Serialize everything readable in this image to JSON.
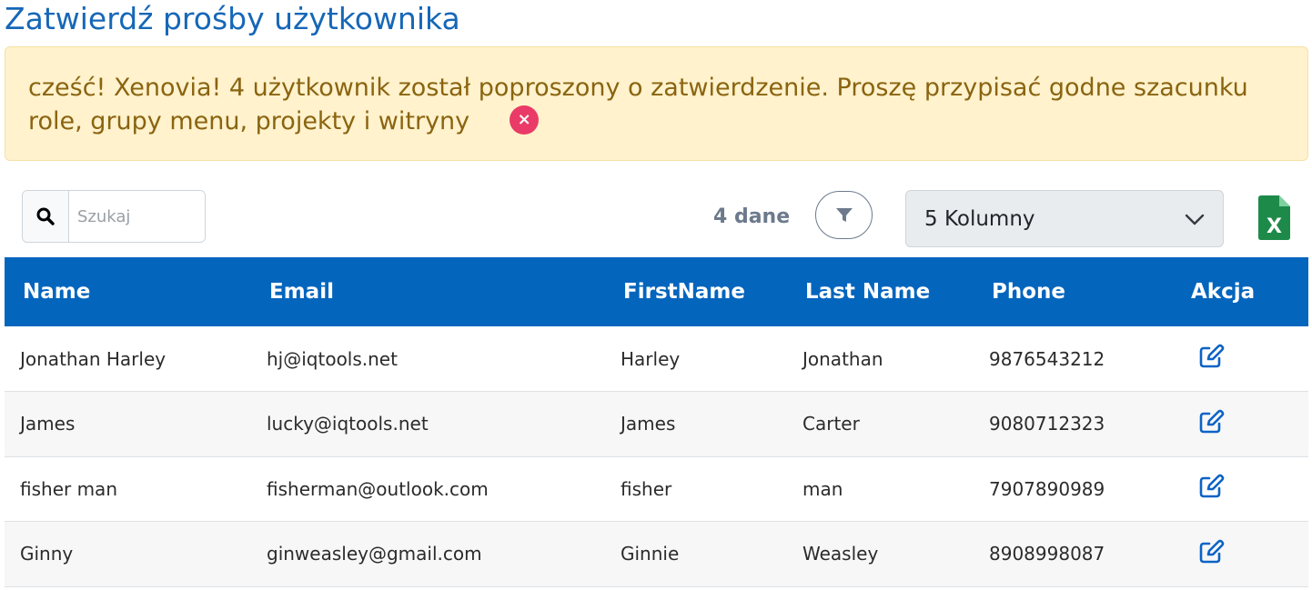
{
  "page": {
    "title": "Zatwierdź prośby użytkownika"
  },
  "alert": {
    "message": "cześć! Xenovia! 4 użytkownik został poproszony o zatwierdzenie. Proszę przypisać godne szacunku role, grupy menu, projekty i witryny",
    "close_glyph": "×",
    "color": "#8a6410",
    "background": "#fff2cd"
  },
  "toolbar": {
    "search_placeholder": "Szukaj",
    "search_value": "",
    "record_count": "4 dane",
    "columns_selected": "5 Kolumny",
    "icons": [
      "search-icon",
      "filter-icon",
      "chevron-down-icon",
      "excel-export-icon"
    ]
  },
  "table": {
    "header_color": "#0465bd",
    "columns": [
      "Name",
      "Email",
      "FirstName",
      "Last Name",
      "Phone",
      "Akcja"
    ],
    "rows": [
      {
        "name": "Jonathan Harley",
        "email": "hj@iqtools.net",
        "first_name": "Harley",
        "last_name": "Jonathan",
        "phone": "9876543212"
      },
      {
        "name": "James",
        "email": "lucky@iqtools.net",
        "first_name": "James",
        "last_name": "Carter",
        "phone": "9080712323"
      },
      {
        "name": "fisher man",
        "email": "fisherman@outlook.com",
        "first_name": "fisher",
        "last_name": "man",
        "phone": "7907890989"
      },
      {
        "name": "Ginny",
        "email": "ginweasley@gmail.com",
        "first_name": "Ginnie",
        "last_name": "Weasley",
        "phone": "8908998087"
      }
    ],
    "action_icon": "edit-icon"
  }
}
